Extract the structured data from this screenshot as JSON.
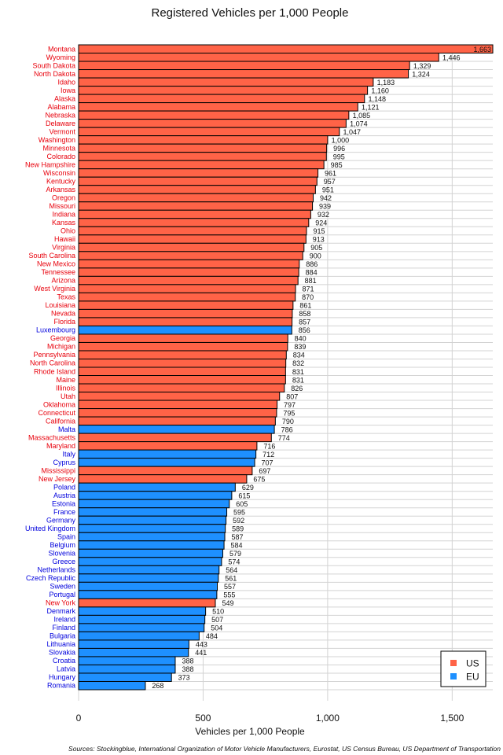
{
  "chart_data": {
    "type": "bar",
    "orientation": "horizontal",
    "title": "Registered Vehicles per 1,000 People",
    "xlabel": "Vehicles per 1,000 People",
    "ylabel": "",
    "xlim": [
      0,
      1663
    ],
    "xticks": [
      0,
      500,
      1000,
      1500
    ],
    "xtick_labels": [
      "0",
      "500",
      "1,000",
      "1,500"
    ],
    "grid": true,
    "legend": {
      "placement": "bottom-right",
      "entries": [
        {
          "name": "US",
          "color": "#ff6347"
        },
        {
          "name": "EU",
          "color": "#1e90ff"
        }
      ]
    },
    "colors": {
      "US": "#ff6347",
      "EU": "#1e90ff",
      "US_label": "#e8000b",
      "EU_label": "#0000dd"
    },
    "source": "Sources: Stockingblue, International Organization of Motor Vehicle Manufacturers, Eurostat, US Census Bureau, US Department of Transportation",
    "bars": [
      {
        "name": "Montana",
        "group": "US",
        "value": 1663,
        "label": "1,663"
      },
      {
        "name": "Wyoming",
        "group": "US",
        "value": 1446,
        "label": "1,446"
      },
      {
        "name": "South Dakota",
        "group": "US",
        "value": 1329,
        "label": "1,329"
      },
      {
        "name": "North Dakota",
        "group": "US",
        "value": 1324,
        "label": "1,324"
      },
      {
        "name": "Idaho",
        "group": "US",
        "value": 1183,
        "label": "1,183"
      },
      {
        "name": "Iowa",
        "group": "US",
        "value": 1160,
        "label": "1,160"
      },
      {
        "name": "Alaska",
        "group": "US",
        "value": 1148,
        "label": "1,148"
      },
      {
        "name": "Alabama",
        "group": "US",
        "value": 1121,
        "label": "1,121"
      },
      {
        "name": "Nebraska",
        "group": "US",
        "value": 1085,
        "label": "1,085"
      },
      {
        "name": "Delaware",
        "group": "US",
        "value": 1074,
        "label": "1,074"
      },
      {
        "name": "Vermont",
        "group": "US",
        "value": 1047,
        "label": "1,047"
      },
      {
        "name": "Washington",
        "group": "US",
        "value": 1000,
        "label": "1,000"
      },
      {
        "name": "Minnesota",
        "group": "US",
        "value": 996,
        "label": "996"
      },
      {
        "name": "Colorado",
        "group": "US",
        "value": 995,
        "label": "995"
      },
      {
        "name": "New Hampshire",
        "group": "US",
        "value": 985,
        "label": "985"
      },
      {
        "name": "Wisconsin",
        "group": "US",
        "value": 961,
        "label": "961"
      },
      {
        "name": "Kentucky",
        "group": "US",
        "value": 957,
        "label": "957"
      },
      {
        "name": "Arkansas",
        "group": "US",
        "value": 951,
        "label": "951"
      },
      {
        "name": "Oregon",
        "group": "US",
        "value": 942,
        "label": "942"
      },
      {
        "name": "Missouri",
        "group": "US",
        "value": 939,
        "label": "939"
      },
      {
        "name": "Indiana",
        "group": "US",
        "value": 932,
        "label": "932"
      },
      {
        "name": "Kansas",
        "group": "US",
        "value": 924,
        "label": "924"
      },
      {
        "name": "Ohio",
        "group": "US",
        "value": 915,
        "label": "915"
      },
      {
        "name": "Hawaii",
        "group": "US",
        "value": 913,
        "label": "913"
      },
      {
        "name": "Virginia",
        "group": "US",
        "value": 905,
        "label": "905"
      },
      {
        "name": "South Carolina",
        "group": "US",
        "value": 900,
        "label": "900"
      },
      {
        "name": "New Mexico",
        "group": "US",
        "value": 886,
        "label": "886"
      },
      {
        "name": "Tennessee",
        "group": "US",
        "value": 884,
        "label": "884"
      },
      {
        "name": "Arizona",
        "group": "US",
        "value": 881,
        "label": "881"
      },
      {
        "name": "West Virginia",
        "group": "US",
        "value": 871,
        "label": "871"
      },
      {
        "name": "Texas",
        "group": "US",
        "value": 870,
        "label": "870"
      },
      {
        "name": "Louisiana",
        "group": "US",
        "value": 861,
        "label": "861"
      },
      {
        "name": "Nevada",
        "group": "US",
        "value": 858,
        "label": "858"
      },
      {
        "name": "Florida",
        "group": "US",
        "value": 857,
        "label": "857"
      },
      {
        "name": "Luxembourg",
        "group": "EU",
        "value": 856,
        "label": "856"
      },
      {
        "name": "Georgia",
        "group": "US",
        "value": 840,
        "label": "840"
      },
      {
        "name": "Michigan",
        "group": "US",
        "value": 839,
        "label": "839"
      },
      {
        "name": "Pennsylvania",
        "group": "US",
        "value": 834,
        "label": "834"
      },
      {
        "name": "North Carolina",
        "group": "US",
        "value": 832,
        "label": "832"
      },
      {
        "name": "Rhode Island",
        "group": "US",
        "value": 831,
        "label": "831"
      },
      {
        "name": "Maine",
        "group": "US",
        "value": 831,
        "label": "831"
      },
      {
        "name": "Illinois",
        "group": "US",
        "value": 826,
        "label": "826"
      },
      {
        "name": "Utah",
        "group": "US",
        "value": 807,
        "label": "807"
      },
      {
        "name": "Oklahoma",
        "group": "US",
        "value": 797,
        "label": "797"
      },
      {
        "name": "Connecticut",
        "group": "US",
        "value": 795,
        "label": "795"
      },
      {
        "name": "California",
        "group": "US",
        "value": 790,
        "label": "790"
      },
      {
        "name": "Malta",
        "group": "EU",
        "value": 786,
        "label": "786"
      },
      {
        "name": "Massachusetts",
        "group": "US",
        "value": 774,
        "label": "774"
      },
      {
        "name": "Maryland",
        "group": "US",
        "value": 716,
        "label": "716"
      },
      {
        "name": "Italy",
        "group": "EU",
        "value": 712,
        "label": "712"
      },
      {
        "name": "Cyprus",
        "group": "EU",
        "value": 707,
        "label": "707"
      },
      {
        "name": "Mississippi",
        "group": "US",
        "value": 697,
        "label": "697"
      },
      {
        "name": "New Jersey",
        "group": "US",
        "value": 675,
        "label": "675"
      },
      {
        "name": "Poland",
        "group": "EU",
        "value": 629,
        "label": "629"
      },
      {
        "name": "Austria",
        "group": "EU",
        "value": 615,
        "label": "615"
      },
      {
        "name": "Estonia",
        "group": "EU",
        "value": 605,
        "label": "605"
      },
      {
        "name": "France",
        "group": "EU",
        "value": 595,
        "label": "595"
      },
      {
        "name": "Germany",
        "group": "EU",
        "value": 592,
        "label": "592"
      },
      {
        "name": "United Kingdom",
        "group": "EU",
        "value": 589,
        "label": "589"
      },
      {
        "name": "Spain",
        "group": "EU",
        "value": 587,
        "label": "587"
      },
      {
        "name": "Belgium",
        "group": "EU",
        "value": 584,
        "label": "584"
      },
      {
        "name": "Slovenia",
        "group": "EU",
        "value": 579,
        "label": "579"
      },
      {
        "name": "Greece",
        "group": "EU",
        "value": 574,
        "label": "574"
      },
      {
        "name": "Netherlands",
        "group": "EU",
        "value": 564,
        "label": "564"
      },
      {
        "name": "Czech Republic",
        "group": "EU",
        "value": 561,
        "label": "561"
      },
      {
        "name": "Sweden",
        "group": "EU",
        "value": 557,
        "label": "557"
      },
      {
        "name": "Portugal",
        "group": "EU",
        "value": 555,
        "label": "555"
      },
      {
        "name": "New York",
        "group": "US",
        "value": 549,
        "label": "549"
      },
      {
        "name": "Denmark",
        "group": "EU",
        "value": 510,
        "label": "510"
      },
      {
        "name": "Ireland",
        "group": "EU",
        "value": 507,
        "label": "507"
      },
      {
        "name": "Finland",
        "group": "EU",
        "value": 504,
        "label": "504"
      },
      {
        "name": "Bulgaria",
        "group": "EU",
        "value": 484,
        "label": "484"
      },
      {
        "name": "Lithuania",
        "group": "EU",
        "value": 443,
        "label": "443"
      },
      {
        "name": "Slovakia",
        "group": "EU",
        "value": 441,
        "label": "441"
      },
      {
        "name": "Croatia",
        "group": "EU",
        "value": 388,
        "label": "388"
      },
      {
        "name": "Latvia",
        "group": "EU",
        "value": 388,
        "label": "388"
      },
      {
        "name": "Hungary",
        "group": "EU",
        "value": 373,
        "label": "373"
      },
      {
        "name": "Romania",
        "group": "EU",
        "value": 268,
        "label": "268"
      }
    ]
  }
}
